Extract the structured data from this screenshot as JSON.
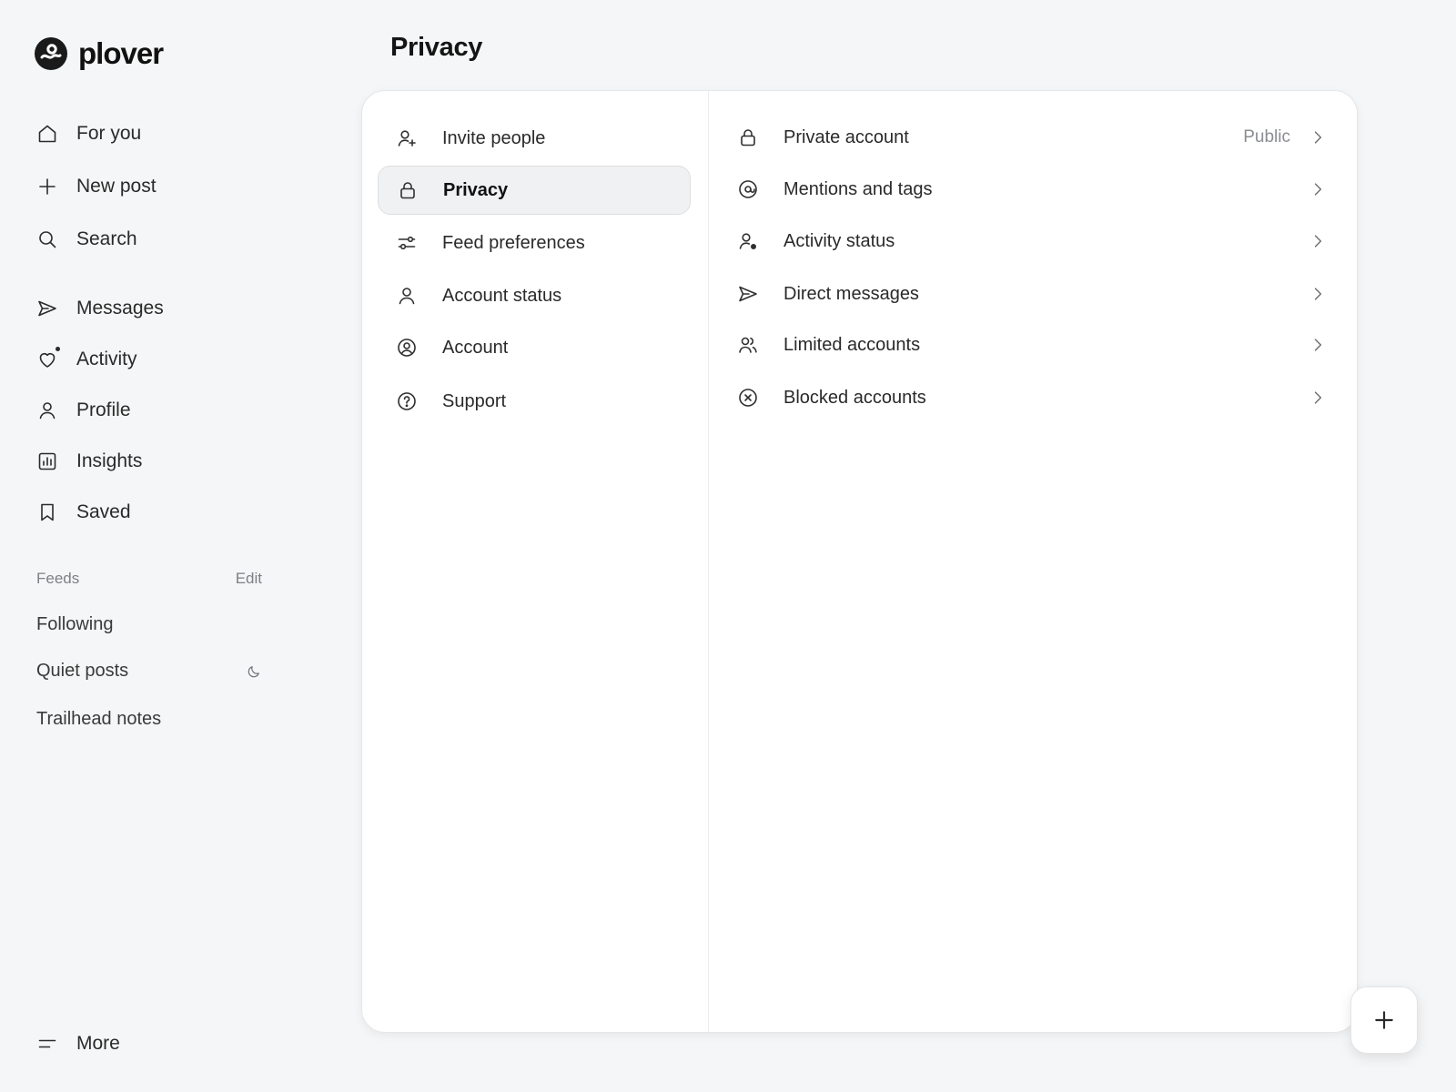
{
  "app": {
    "name": "plover"
  },
  "page": {
    "title": "Privacy"
  },
  "sidebar": {
    "nav": [
      {
        "label": "For you",
        "icon": "home-icon"
      },
      {
        "label": "New post",
        "icon": "plus-icon"
      },
      {
        "label": "Search",
        "icon": "search-icon"
      },
      {
        "label": "Messages",
        "icon": "send-icon"
      },
      {
        "label": "Activity",
        "icon": "heart-icon"
      },
      {
        "label": "Profile",
        "icon": "person-icon"
      },
      {
        "label": "Insights",
        "icon": "chart-icon"
      },
      {
        "label": "Saved",
        "icon": "bookmark-icon"
      }
    ],
    "feeds_heading": "Feeds",
    "feeds_edit": "Edit",
    "feeds": [
      {
        "label": "Following"
      },
      {
        "label": "Quiet posts",
        "icon": "moon-icon"
      },
      {
        "label": "Trailhead notes"
      }
    ],
    "more": {
      "label": "More",
      "icon": "menu-icon"
    }
  },
  "settings_menu": [
    {
      "label": "Invite people",
      "icon": "person-add-icon",
      "active": false
    },
    {
      "label": "Privacy",
      "icon": "lock-icon",
      "active": true
    },
    {
      "label": "Feed preferences",
      "icon": "sliders-icon",
      "active": false
    },
    {
      "label": "Account status",
      "icon": "person-icon",
      "active": false
    },
    {
      "label": "Account",
      "icon": "account-circle-icon",
      "active": false
    },
    {
      "label": "Support",
      "icon": "help-icon",
      "active": false
    }
  ],
  "privacy_options": [
    {
      "label": "Private account",
      "value": "Public",
      "icon": "lock-icon"
    },
    {
      "label": "Mentions and tags",
      "value": "",
      "icon": "at-icon"
    },
    {
      "label": "Activity status",
      "value": "",
      "icon": "person-status-icon"
    },
    {
      "label": "Direct messages",
      "value": "",
      "icon": "send-icon"
    },
    {
      "label": "Limited accounts",
      "value": "",
      "icon": "people-icon"
    },
    {
      "label": "Blocked accounts",
      "value": "",
      "icon": "blocked-icon"
    }
  ],
  "fab": {
    "icon": "plus-icon"
  }
}
